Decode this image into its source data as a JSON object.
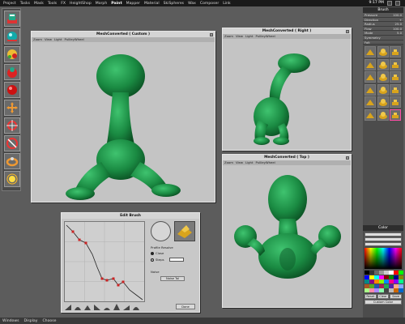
{
  "menubar": {
    "items": [
      "Project",
      "Tasks",
      "Mask",
      "Tools",
      "FX",
      "HeightShop",
      "Morph",
      "Paint",
      "Mapper",
      "Material",
      "SkiSpheres",
      "Wax",
      "Composer",
      "Link"
    ],
    "active_index": 7,
    "clock": "9:17 PM"
  },
  "bottombar": {
    "items": [
      "Windows",
      "Display",
      "Choose"
    ]
  },
  "toolstrip": {
    "icons": [
      "paint-brush-icon",
      "smooth-sphere-icon",
      "material-ball-icon",
      "mask-ball-icon",
      "red-ball-icon",
      "move-axis-icon",
      "rotate-axis-icon",
      "scale-axis-icon",
      "torus-icon",
      "lamp-icon"
    ]
  },
  "brush_panel": {
    "title": "Brush",
    "settings": [
      {
        "label": "Pressure",
        "value": "100.0"
      },
      {
        "label": "Direction",
        "value": "+"
      },
      {
        "label": "Radius",
        "value": "25.0"
      },
      {
        "label": "Flow",
        "value": "100.0"
      },
      {
        "label": "Mode",
        "value": "5.0"
      },
      {
        "label": "Symmetry",
        "value": ""
      },
      {
        "label": "Falt",
        "value": ""
      }
    ],
    "brushes": 18,
    "selected_brush": 17
  },
  "color_panel": {
    "title": "Color",
    "buttons": [
      "Reset",
      "Clear",
      "Save"
    ],
    "footer_button": "Custom Color"
  },
  "windows": {
    "custom": {
      "title": "MeshConverted ( Custom )",
      "menu": [
        "Zoom",
        "View",
        "Light",
        "PullleyWheel"
      ]
    },
    "right": {
      "title": "MeshConverted ( Right )",
      "menu": [
        "Zoom",
        "View",
        "Light",
        "PullleyWheel"
      ]
    },
    "top": {
      "title": "MeshConverted ( Top )",
      "menu": [
        "Zoom",
        "View",
        "Light",
        "PullleyWheel"
      ]
    }
  },
  "edit_brush": {
    "title": "Edit Brush",
    "profile_label": "Profile Resolve",
    "option_close": "Close",
    "option_steps": "Steps",
    "noise_label": "Noise",
    "noise_value": "Noise Tal",
    "done_label": "Done"
  },
  "colors": {
    "mesh": "#1f8f46",
    "mesh_dark": "#0d5a2a",
    "viewport": "#c4c4c4",
    "background": "#5c5c5c",
    "selection": "#ff4da6"
  }
}
